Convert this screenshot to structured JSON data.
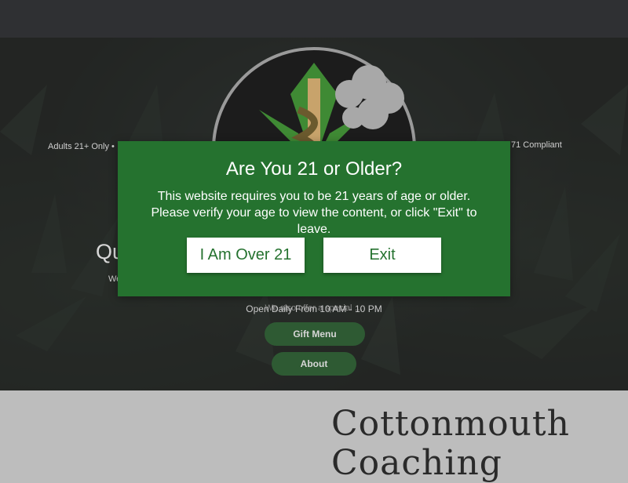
{
  "hero": {
    "left_badge": "Adults 21+ Only •",
    "right_badge": "71 Compliant",
    "heading_fragment": "Qu",
    "line_fragment": "We",
    "obscured_line": "We also offer a special …",
    "hours": "Open Daily From 10 AM - 10 PM",
    "gift_menu_label": "Gift Menu",
    "about_label": "About"
  },
  "brand": {
    "name": "Cottonmouth Coaching"
  },
  "age_gate": {
    "title": "Are You 21 or Older?",
    "message": "This website requires you to be 21 years of age or older. Please verify your age to view the content, or click \"Exit\" to leave.",
    "confirm_label": "I Am Over 21",
    "exit_label": "Exit"
  },
  "colors": {
    "modal_bg": "#25722f",
    "button_text": "#25722f",
    "pill_bg": "#2e5a33",
    "topbar": "#2f3033"
  }
}
